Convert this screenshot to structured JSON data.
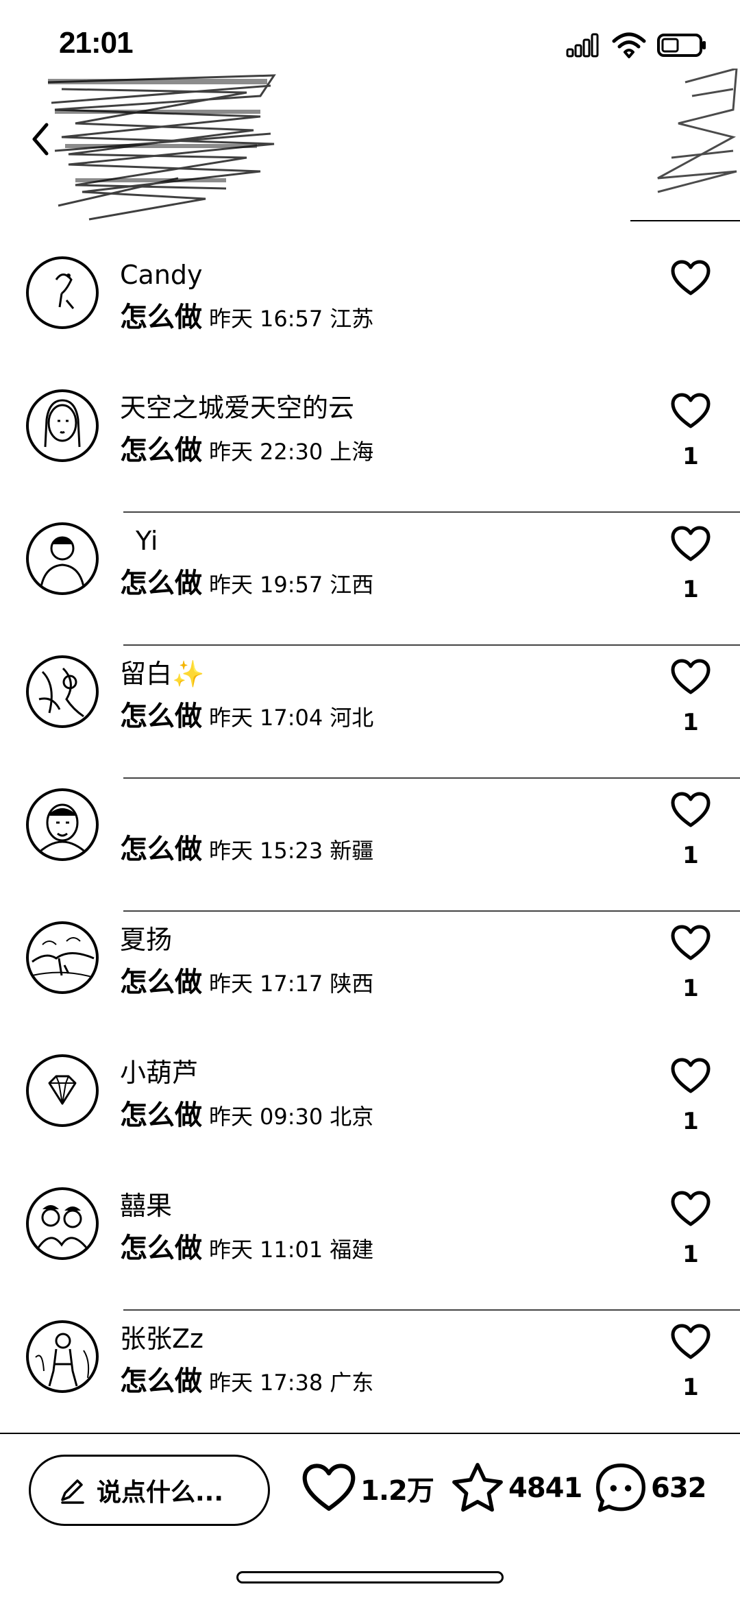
{
  "status_bar": {
    "time": "21:01"
  },
  "comments": [
    {
      "name": "Candy",
      "text": "怎么做",
      "date": "昨天",
      "time": "16:57",
      "location": "江苏",
      "likes": "",
      "avatar": "sketch-avatar"
    },
    {
      "name": "天空之城爱天空的云",
      "text": "怎么做",
      "date": "昨天",
      "time": "22:30",
      "location": "上海",
      "likes": "1",
      "avatar": "portrait-avatar"
    },
    {
      "name": "Yi",
      "text": "怎么做",
      "date": "昨天",
      "time": "19:57",
      "location": "江西",
      "likes": "1",
      "avatar": "portrait-avatar"
    },
    {
      "name": "留白✨",
      "text": "怎么做",
      "date": "昨天",
      "time": "17:04",
      "location": "河北",
      "likes": "1",
      "avatar": "photo-avatar"
    },
    {
      "name": "",
      "text": "怎么做",
      "date": "昨天",
      "time": "15:23",
      "location": "新疆",
      "likes": "1",
      "avatar": "portrait-avatar"
    },
    {
      "name": "夏扬",
      "text": "怎么做",
      "date": "昨天",
      "time": "17:17",
      "location": "陕西",
      "likes": "1",
      "avatar": "landscape-avatar"
    },
    {
      "name": "小葫芦",
      "text": "怎么做",
      "date": "昨天",
      "time": "09:30",
      "location": "北京",
      "likes": "1",
      "avatar": "diamond-avatar"
    },
    {
      "name": "囍果",
      "text": "怎么做",
      "date": "昨天",
      "time": "11:01",
      "location": "福建",
      "likes": "1",
      "avatar": "group-photo-avatar"
    },
    {
      "name": "张张Zz",
      "text": "怎么做",
      "date": "昨天",
      "time": "17:38",
      "location": "广东",
      "likes": "1",
      "avatar": "photo-avatar"
    }
  ],
  "bottom_bar": {
    "input_placeholder": "说点什么...",
    "like_count": "1.2万",
    "collect_count": "4841",
    "comment_count": "632"
  },
  "colors": {
    "background": "#ffffff",
    "foreground": "#000000"
  }
}
